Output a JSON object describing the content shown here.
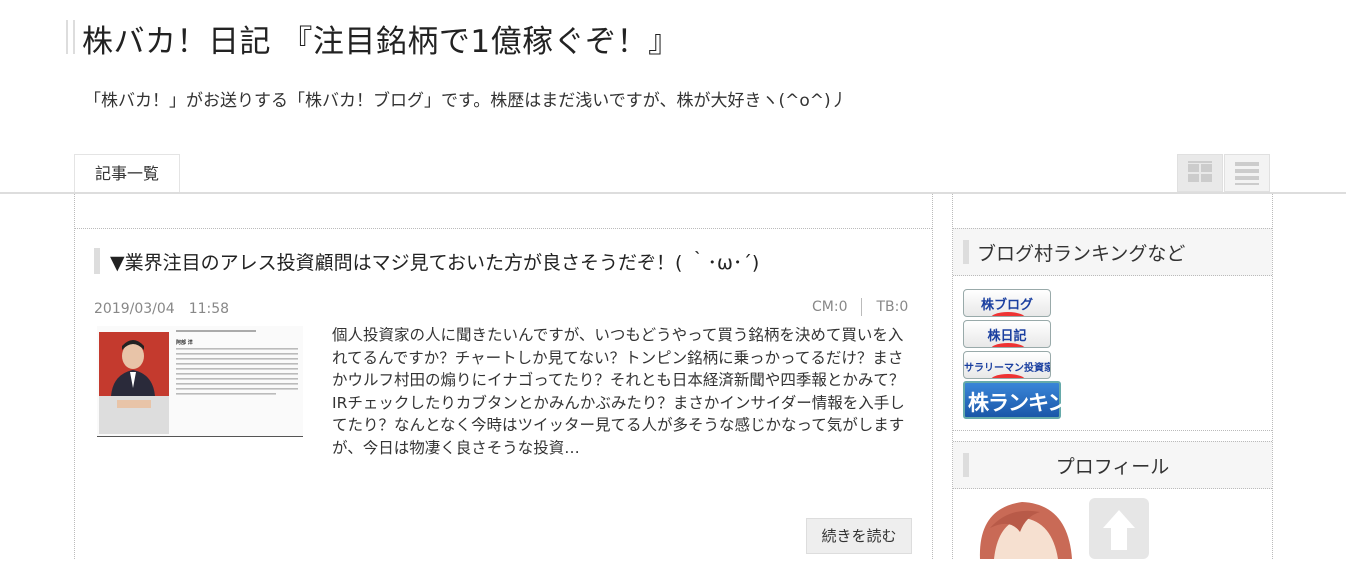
{
  "header": {
    "title": "株バカ！日記 『注目銘柄で1億稼ぐぞ！』",
    "description": "「株バカ！」がお送りする「株バカ！ブログ」です。株歴はまだ浅いですが、株が大好きヽ(^o^)丿"
  },
  "nav": {
    "tab_label": "記事一覧",
    "grid_view_icon": "grid-view-icon",
    "list_view_icon": "list-view-icon"
  },
  "article": {
    "title": "▼業界注目のアレス投資顧問はマジ見ておいた方が良さそうだぞ！( ｀･ω･´)",
    "date": "2019/03/04　11:58",
    "comments": "CM:0",
    "trackbacks": "TB:0",
    "body": "個人投資家の人に聞きたいんですが、いつもどうやって買う銘柄を決めて買いを入れてるんですか？チャートしか見てない？トンピン銘柄に乗っかってるだけ？まさかウルフ村田の煽りにイナゴってたり？それとも日本経済新聞や四季報とかみて？IRチェックしたりカブタンとかみんかぶみたり？まさかインサイダー情報を入手してたり？なんとなく今時はツイッター見てる人が多そうな感じかなって気がしますが、今日は物凄く良さそうな投資…",
    "thumb_name": "阿部 洋",
    "read_more": "続きを読む"
  },
  "sidebar": {
    "ranking_heading": "ブログ村ランキングなど",
    "rank_buttons": [
      "株ブログ",
      "株日記",
      "サラリーマン投資家"
    ],
    "rank_big": "株ランキング",
    "profile_heading": "プロフィール"
  },
  "colors": {
    "accent_blue": "#1a3fa0",
    "rank_red": "#e33333",
    "banner_blue": "#2a6cc0"
  }
}
